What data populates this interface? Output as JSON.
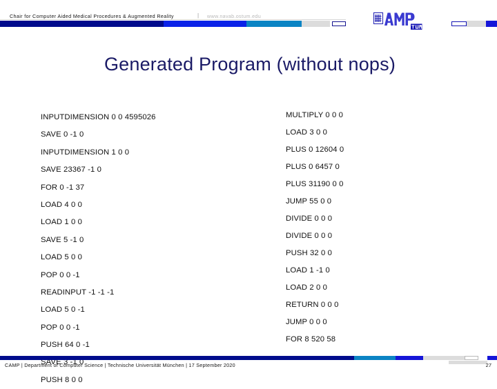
{
  "header": {
    "chair_line": "Chair for Computer Aided Medical Procedures & Augmented Reality",
    "separator": "|",
    "url": "www.navab.ostum.edu",
    "logo_camp": "CAMP",
    "logo_tum": "TUM"
  },
  "slide": {
    "title": "Generated Program (without nops)"
  },
  "program": {
    "left_column": [
      "INPUTDIMENSION 0 0 4595026",
      "SAVE 0 -1 0",
      "INPUTDIMENSION 1 0 0",
      "SAVE 23367 -1 0",
      "FOR 0 -1 37",
      "LOAD 4 0 0",
      "LOAD 1 0 0",
      "SAVE 5 -1 0",
      "LOAD 5 0 0",
      "POP 0 0 -1",
      "READINPUT -1 -1 -1",
      "LOAD 5 0 -1",
      "POP 0 0 -1",
      "PUSH 64 0 -1",
      "SAVE 3 -1 0",
      "PUSH 8 0 0"
    ],
    "right_column": [
      "MULTIPLY 0 0 0",
      "LOAD 3 0 0",
      "PLUS 0 12604 0",
      "PLUS 0 6457 0",
      "PLUS 31190 0 0",
      "JUMP 55 0 0",
      "DIVIDE 0 0 0",
      "DIVIDE 0 0 0",
      "PUSH 32 0 0",
      "LOAD 1 -1 0",
      "LOAD 2 0 0",
      "RETURN 0 0 0",
      "JUMP 0 0 0",
      "FOR 8 520 58"
    ]
  },
  "footer": {
    "text": "CAMP | Department of Computer Science | Technische Universität München | 17 September 2020",
    "page_number": "27"
  },
  "colors": {
    "navy": "#000b8c",
    "blue": "#0b22e8",
    "cyan": "#0b84c4",
    "grey": "#dcdcdc",
    "title": "#1a1a66"
  }
}
